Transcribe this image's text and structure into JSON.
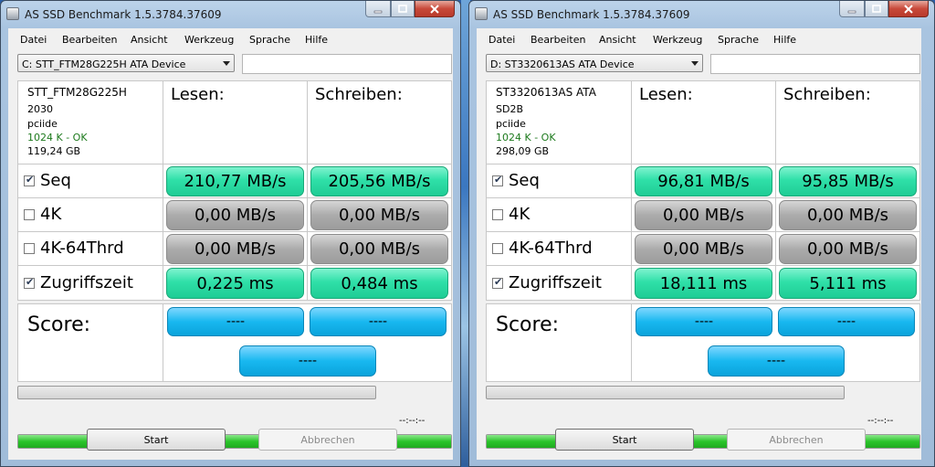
{
  "windows": [
    {
      "title": "AS SSD Benchmark 1.5.3784.37609",
      "menu": [
        "Datei",
        "Bearbeiten",
        "Ansicht",
        "Werkzeug",
        "Sprache",
        "Hilfe"
      ],
      "device_select": "C: STT_FTM28G225H ATA Device",
      "path_value": "",
      "info": {
        "name": "STT_FTM28G225H",
        "firmware": "2030",
        "driver": "pciide",
        "alignment": "1024 K - OK",
        "size": "119,24 GB"
      },
      "headers": {
        "read": "Lesen:",
        "write": "Schreiben:"
      },
      "rows": [
        {
          "label": "Seq",
          "checked": true,
          "read": "210,77 MB/s",
          "write": "205,56 MB/s",
          "status": "done"
        },
        {
          "label": "4K",
          "checked": false,
          "read": "0,00 MB/s",
          "write": "0,00 MB/s",
          "status": "skipped"
        },
        {
          "label": "4K-64Thrd",
          "checked": false,
          "read": "0,00 MB/s",
          "write": "0,00 MB/s",
          "status": "skipped"
        },
        {
          "label": "Zugriffszeit",
          "checked": true,
          "read": "0,225 ms",
          "write": "0,484 ms",
          "status": "done"
        }
      ],
      "score": {
        "label": "Score:",
        "read": "----",
        "write": "----",
        "total": "----"
      },
      "progress": {
        "current": 0,
        "total": 1.0,
        "time": "--:--:--"
      },
      "buttons": {
        "start": "Start",
        "abort": "Abbrechen"
      }
    },
    {
      "title": "AS SSD Benchmark 1.5.3784.37609",
      "menu": [
        "Datei",
        "Bearbeiten",
        "Ansicht",
        "Werkzeug",
        "Sprache",
        "Hilfe"
      ],
      "device_select": "D: ST3320613AS ATA Device",
      "path_value": "",
      "info": {
        "name": "ST3320613AS ATA",
        "firmware": "SD2B",
        "driver": "pciide",
        "alignment": "1024 K - OK",
        "size": "298,09 GB"
      },
      "headers": {
        "read": "Lesen:",
        "write": "Schreiben:"
      },
      "rows": [
        {
          "label": "Seq",
          "checked": true,
          "read": "96,81 MB/s",
          "write": "95,85 MB/s",
          "status": "done"
        },
        {
          "label": "4K",
          "checked": false,
          "read": "0,00 MB/s",
          "write": "0,00 MB/s",
          "status": "skipped"
        },
        {
          "label": "4K-64Thrd",
          "checked": false,
          "read": "0,00 MB/s",
          "write": "0,00 MB/s",
          "status": "skipped"
        },
        {
          "label": "Zugriffszeit",
          "checked": true,
          "read": "18,111 ms",
          "write": "5,111 ms",
          "status": "done"
        }
      ],
      "score": {
        "label": "Score:",
        "read": "----",
        "write": "----",
        "total": "----"
      },
      "progress": {
        "current": 0,
        "total": 1.0,
        "time": "--:--:--"
      },
      "buttons": {
        "start": "Start",
        "abort": "Abbrechen"
      }
    }
  ],
  "colors": {
    "result_done": "#2fe0a8",
    "result_skipped": "#ababab",
    "score": "#18b8f0",
    "progress_fill": "#2bc52b"
  },
  "icons": {
    "app": "drive-icon",
    "check": "checkmark-icon",
    "dropdown": "chevron-down-icon"
  }
}
